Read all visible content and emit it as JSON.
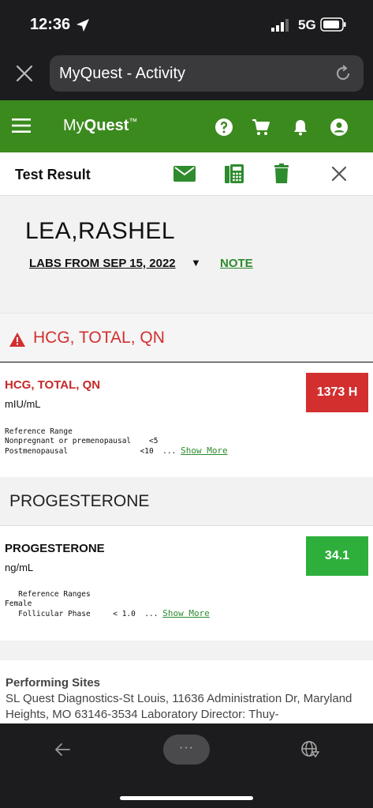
{
  "status_bar": {
    "time": "12:36",
    "network": "5G"
  },
  "browser": {
    "url_title": "MyQuest - Activity"
  },
  "app_header": {
    "brand_light": "My",
    "brand_bold": "Quest",
    "brand_tm": "™"
  },
  "toolbar": {
    "title": "Test Result"
  },
  "patient": {
    "name": "LEA,RASHEL",
    "labs_label": "LABS FROM SEP 15, 2022",
    "caret": "▼",
    "note_label": "NOTE"
  },
  "sections": [
    {
      "header": "HCG, TOTAL, QN",
      "alert": true,
      "result": {
        "name": "HCG, TOTAL, QN",
        "unit": "mIU/mL",
        "value": "1373 H",
        "value_color": "#d32f2f",
        "reference": "Reference Range\nNonpregnant or premenopausal    <5\nPostmenopausal                <10  ...",
        "show_more": "Show More"
      }
    },
    {
      "header": "PROGESTERONE",
      "alert": false,
      "result": {
        "name": "PROGESTERONE",
        "unit": "ng/mL",
        "value": "34.1",
        "value_color": "#2eaf3c",
        "reference": "   Reference Ranges\nFemale\n   Follicular Phase     < 1.0  ...",
        "show_more": "Show More"
      }
    }
  ],
  "performing_sites": {
    "title": "Performing Sites",
    "body": "SL Quest Diagnostics-St Louis, 11636 Administration Dr, Maryland Heights, MO 63146-3534 Laboratory Director: Thuy-"
  },
  "bottom_bar": {
    "more_label": "···"
  },
  "colors": {
    "brand_green": "#3b8a1e",
    "alert_red": "#d32f2f",
    "link_green": "#2e8b2e"
  }
}
